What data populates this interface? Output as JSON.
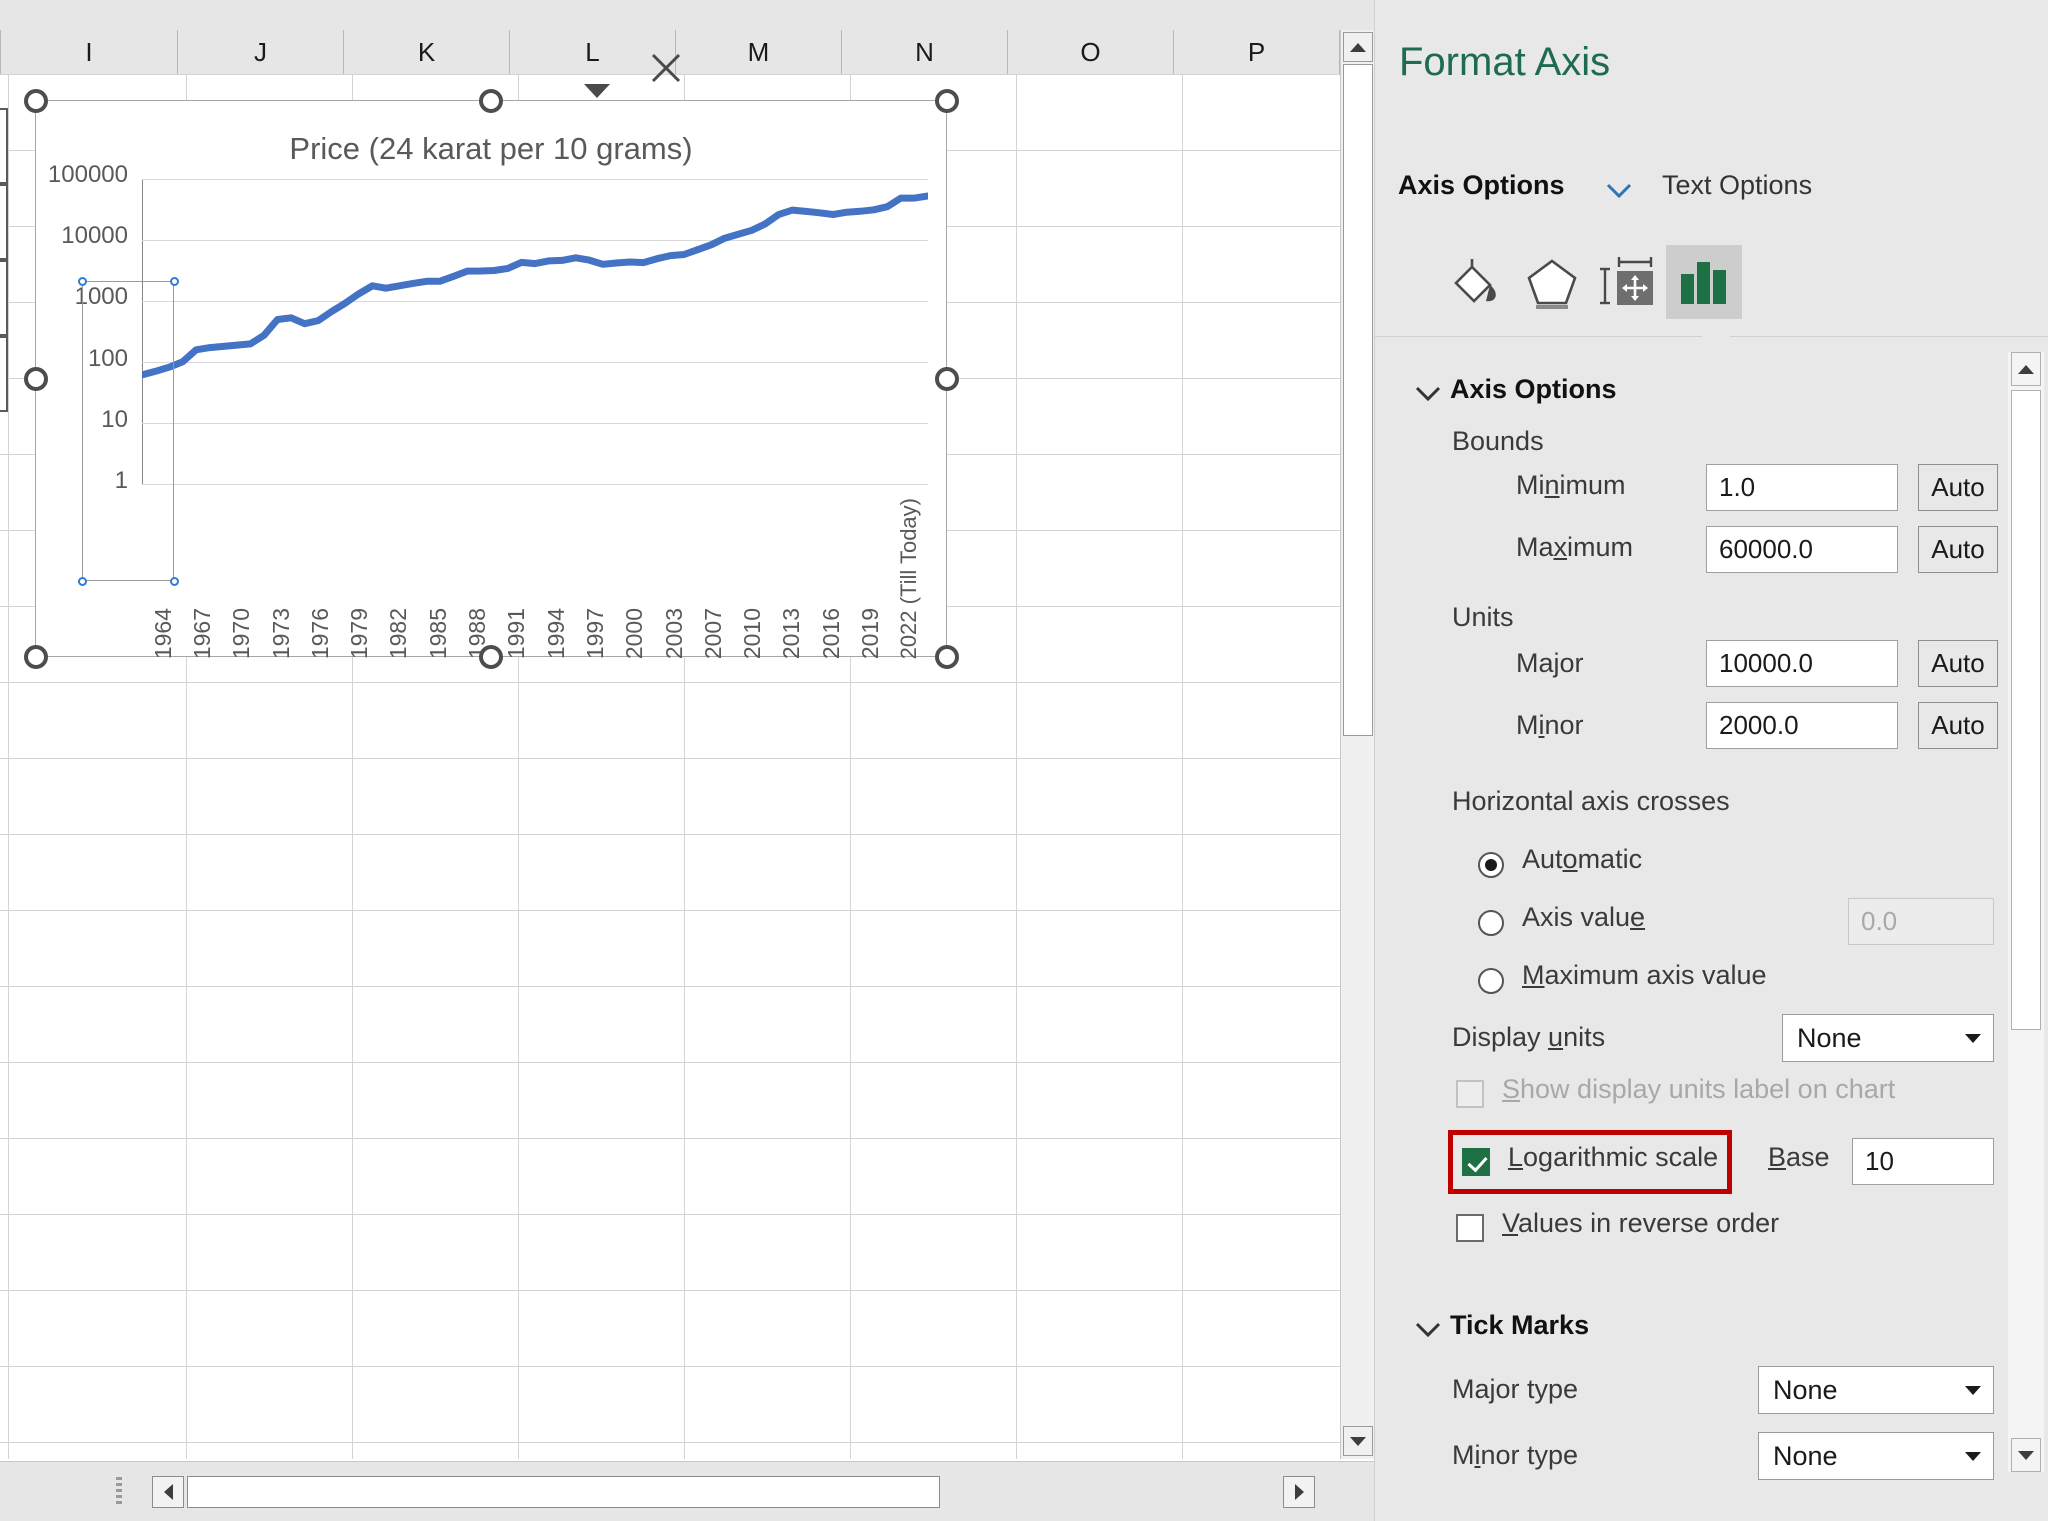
{
  "spreadsheet": {
    "column_headers": [
      "I",
      "J",
      "K",
      "L",
      "M",
      "N",
      "O",
      "P"
    ]
  },
  "chart_data": {
    "type": "line",
    "title": "Price (24 karat per 10 grams)",
    "xlabel": "",
    "ylabel": "",
    "log_scale": true,
    "log_base": 10,
    "grid": true,
    "legend": "none",
    "series_color": "#4472c4",
    "ylim": [
      1,
      100000
    ],
    "ytick_labels": [
      "100000",
      "10000",
      "1000",
      "100",
      "10",
      "1"
    ],
    "ytick_values": [
      100000,
      10000,
      1000,
      100,
      10,
      1
    ],
    "xtick_labels": [
      "1964",
      "1967",
      "1970",
      "1973",
      "1976",
      "1979",
      "1982",
      "1985",
      "1988",
      "1991",
      "1994",
      "1997",
      "2000",
      "2003",
      "2007",
      "2010",
      "2013",
      "2016",
      "2019",
      "2022 (Till Today)"
    ],
    "series": [
      {
        "name": "Price (24 karat per 10 grams)",
        "x": [
          1964,
          1965,
          1966,
          1967,
          1968,
          1969,
          1970,
          1971,
          1972,
          1973,
          1974,
          1975,
          1976,
          1977,
          1978,
          1979,
          1980,
          1981,
          1982,
          1983,
          1984,
          1985,
          1986,
          1987,
          1988,
          1989,
          1990,
          1991,
          1992,
          1993,
          1994,
          1995,
          1996,
          1997,
          1998,
          1999,
          2000,
          2001,
          2002,
          2003,
          2004,
          2005,
          2006,
          2007,
          2008,
          2009,
          2010,
          2011,
          2012,
          2013,
          2014,
          2015,
          2016,
          2017,
          2018,
          2019,
          2020,
          2021,
          2022
        ],
        "values": [
          63,
          72,
          84,
          103,
          162,
          176,
          184,
          193,
          202,
          279,
          506,
          540,
          432,
          486,
          685,
          937,
          1330,
          1800,
          1645,
          1800,
          1970,
          2130,
          2140,
          2570,
          3130,
          3140,
          3200,
          3466,
          4334,
          4140,
          4598,
          4680,
          5160,
          4725,
          4045,
          4234,
          4400,
          4300,
          4990,
          5600,
          5850,
          7000,
          8400,
          10800,
          12500,
          14500,
          18500,
          26400,
          31050,
          29600,
          28006,
          26343,
          28623,
          29667,
          31438,
          35220,
          48651,
          48720,
          52670
        ]
      }
    ]
  },
  "panel": {
    "title": "Format Axis",
    "dropdown_icon": "chevron-down-icon",
    "close_icon": "close-icon",
    "tabs": {
      "axis_options": "Axis Options",
      "axis_options_caret": "chevron-down-icon",
      "text_options": "Text Options"
    },
    "icon_tabs": [
      {
        "name": "fill-line-icon",
        "active": false
      },
      {
        "name": "effects-pentagon-icon",
        "active": false
      },
      {
        "name": "size-properties-icon",
        "active": false
      },
      {
        "name": "axis-options-chart-icon",
        "active": true
      }
    ],
    "sections": {
      "axis_options": {
        "heading": "Axis Options",
        "caret": "chevron-down-icon",
        "bounds": {
          "group_label": "Bounds",
          "minimum_label": "Minimum",
          "minimum_label_pre": "Mi",
          "minimum_label_mnemonic": "n",
          "minimum_label_post": "imum",
          "minimum_value": "1.0",
          "minimum_auto": "Auto",
          "maximum_label_pre": "Ma",
          "maximum_label_mnemonic": "x",
          "maximum_label_post": "imum",
          "maximum_value": "60000.0",
          "maximum_auto": "Auto"
        },
        "units": {
          "group_label": "Units",
          "major_label_pre": "Ma",
          "major_label_mnemonic": "j",
          "major_label_post": "or",
          "major_value": "10000.0",
          "major_auto": "Auto",
          "minor_label_pre": "M",
          "minor_label_mnemonic": "i",
          "minor_label_post": "nor",
          "minor_value": "2000.0",
          "minor_auto": "Auto"
        },
        "horizontal_axis_crosses": {
          "group_label": "Horizontal axis crosses",
          "automatic_pre": "Aut",
          "automatic_mnemonic": "o",
          "automatic_post": "matic",
          "automatic_selected": true,
          "axis_value_pre": "Axis valu",
          "axis_value_mnemonic": "e",
          "axis_value_post": "",
          "axis_value_selected": false,
          "axis_value_input": "0.0",
          "axis_value_input_disabled": true,
          "maximum_axis_value_pre": "",
          "maximum_axis_value_mnemonic": "M",
          "maximum_axis_value_post": "aximum axis value",
          "maximum_axis_value_selected": false
        },
        "display_units_label_pre": "Display ",
        "display_units_label_mnemonic": "u",
        "display_units_label_post": "nits",
        "display_units_value": "None",
        "show_display_units_pre": "",
        "show_display_units_mnemonic": "S",
        "show_display_units_post": "how display units label on chart",
        "show_display_units_checked": false,
        "show_display_units_disabled": true,
        "logarithmic_scale_pre": "",
        "logarithmic_scale_mnemonic": "L",
        "logarithmic_scale_post": "ogarithmic scale",
        "logarithmic_scale_checked": true,
        "logarithmic_highlight_color": "#c00000",
        "base_label_pre": "",
        "base_label_mnemonic": "B",
        "base_label_post": "ase",
        "base_value": "10",
        "values_reverse_pre": "",
        "values_reverse_mnemonic": "V",
        "values_reverse_post": "alues in reverse order",
        "values_reverse_checked": false
      },
      "tick_marks": {
        "heading": "Tick Marks",
        "caret": "chevron-down-icon",
        "major_type_pre": "Ma",
        "major_type_mnemonic": "j",
        "major_type_post": "or type",
        "major_type_value": "None",
        "minor_type_pre": "M",
        "minor_type_mnemonic": "i",
        "minor_type_post": "nor type",
        "minor_type_value": "None"
      }
    }
  },
  "scrollbars": {
    "sheet_vertical_up": "scroll-up-icon",
    "sheet_vertical_down": "scroll-down-icon",
    "sheet_horizontal_left": "scroll-left-icon",
    "sheet_horizontal_right": "scroll-right-icon",
    "panel_vertical_up": "scroll-up-icon",
    "panel_vertical_down": "scroll-down-icon"
  }
}
